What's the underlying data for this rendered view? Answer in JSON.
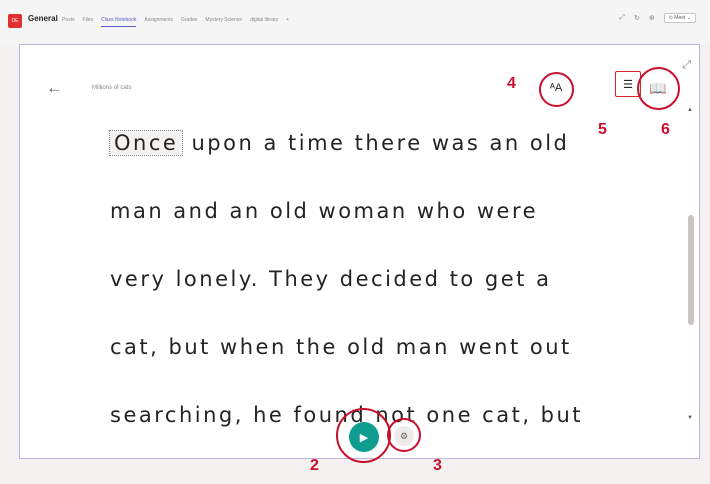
{
  "header": {
    "team_icon_text": "DE",
    "channel": "General",
    "tabs": [
      {
        "label": "Posts"
      },
      {
        "label": "Files"
      },
      {
        "label": "Class Notebook",
        "active": true
      },
      {
        "label": "Assignments"
      },
      {
        "label": "Grades"
      },
      {
        "label": "Mystery Science"
      },
      {
        "label": "digital library"
      }
    ],
    "add_tab": "+",
    "meet_label": "Meet"
  },
  "reader": {
    "doc_title": "Millions of cats",
    "lines": [
      {
        "highlight": "Once",
        "rest": " upon a time there was an old"
      },
      {
        "text": "man and an old woman who were"
      },
      {
        "text": "very lonely. They decided to get a"
      },
      {
        "text": "cat, but when the old man went out"
      },
      {
        "text": "searching, he found not one cat, but"
      }
    ],
    "text_pref_label": "ᴬA"
  },
  "callouts": {
    "play": "2",
    "voice": "3",
    "text_preferences": "4",
    "line_focus": "5",
    "dictionary": "6"
  },
  "colors": {
    "annotation": "#c8102e",
    "play_button": "#0f9d8f",
    "active_tab": "#5b5fc7"
  },
  "icons": [
    "back-arrow-icon",
    "text-preferences-icon",
    "line-focus-icon",
    "dictionary-book-icon",
    "play-icon",
    "voice-settings-icon",
    "expand-icon"
  ]
}
